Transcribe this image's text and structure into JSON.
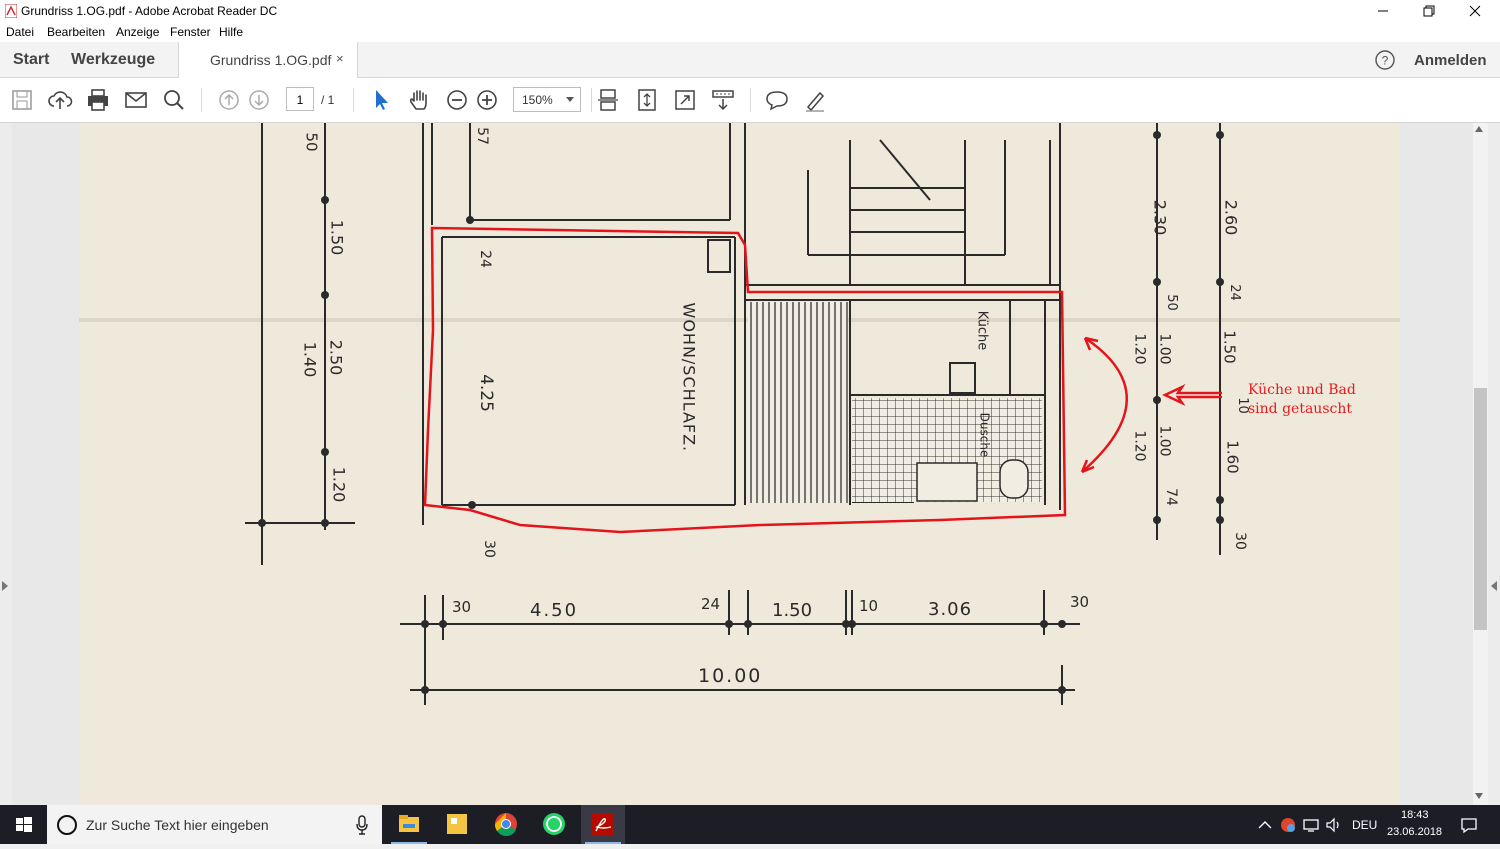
{
  "window": {
    "title": "Grundriss 1.OG.pdf - Adobe Acrobat Reader DC"
  },
  "menu": {
    "items": [
      "Datei",
      "Bearbeiten",
      "Anzeige",
      "Fenster",
      "Hilfe"
    ]
  },
  "tabs": {
    "start": "Start",
    "tools": "Werkzeuge",
    "document": "Grundriss 1.OG.pdf",
    "close": "×"
  },
  "account": {
    "signin": "Anmelden"
  },
  "toolbar": {
    "page_current": "1",
    "page_total": "/ 1",
    "zoom": "150%"
  },
  "document": {
    "room_label": "WOHN/SCHLAFZ.",
    "kitchen_label": "Küche",
    "bath_label": "Dusche",
    "dim_left": [
      "50",
      "1.50",
      "2.50",
      "1.40",
      "1.20"
    ],
    "dim_right_a": [
      "2.30",
      "50",
      "1.00",
      "1.20",
      "1.00",
      "1.20",
      "74"
    ],
    "dim_right_b": [
      "2.60",
      "24",
      "1.50",
      "10",
      "1.60",
      "30"
    ],
    "dim_room_height": "4.25",
    "dim_top_inner": "24",
    "dim_bottom_inner": "30",
    "dim_top_stair": "57",
    "dim_row": [
      "30",
      "4.50",
      "24",
      "1.50",
      "10",
      "3.06",
      "30"
    ],
    "dim_total": "10.00",
    "annotation": [
      "Küche und Bad",
      "sind getauscht"
    ],
    "annotation_color": "#e8191c"
  },
  "taskbar": {
    "search_placeholder": "Zur Suche Text hier eingeben",
    "apps": [
      "file-explorer-icon",
      "sticky-notes-icon",
      "chrome-icon",
      "whatsapp-icon",
      "acrobat-icon"
    ],
    "lang": "DEU",
    "time": "18:43",
    "date": "23.06.2018"
  }
}
